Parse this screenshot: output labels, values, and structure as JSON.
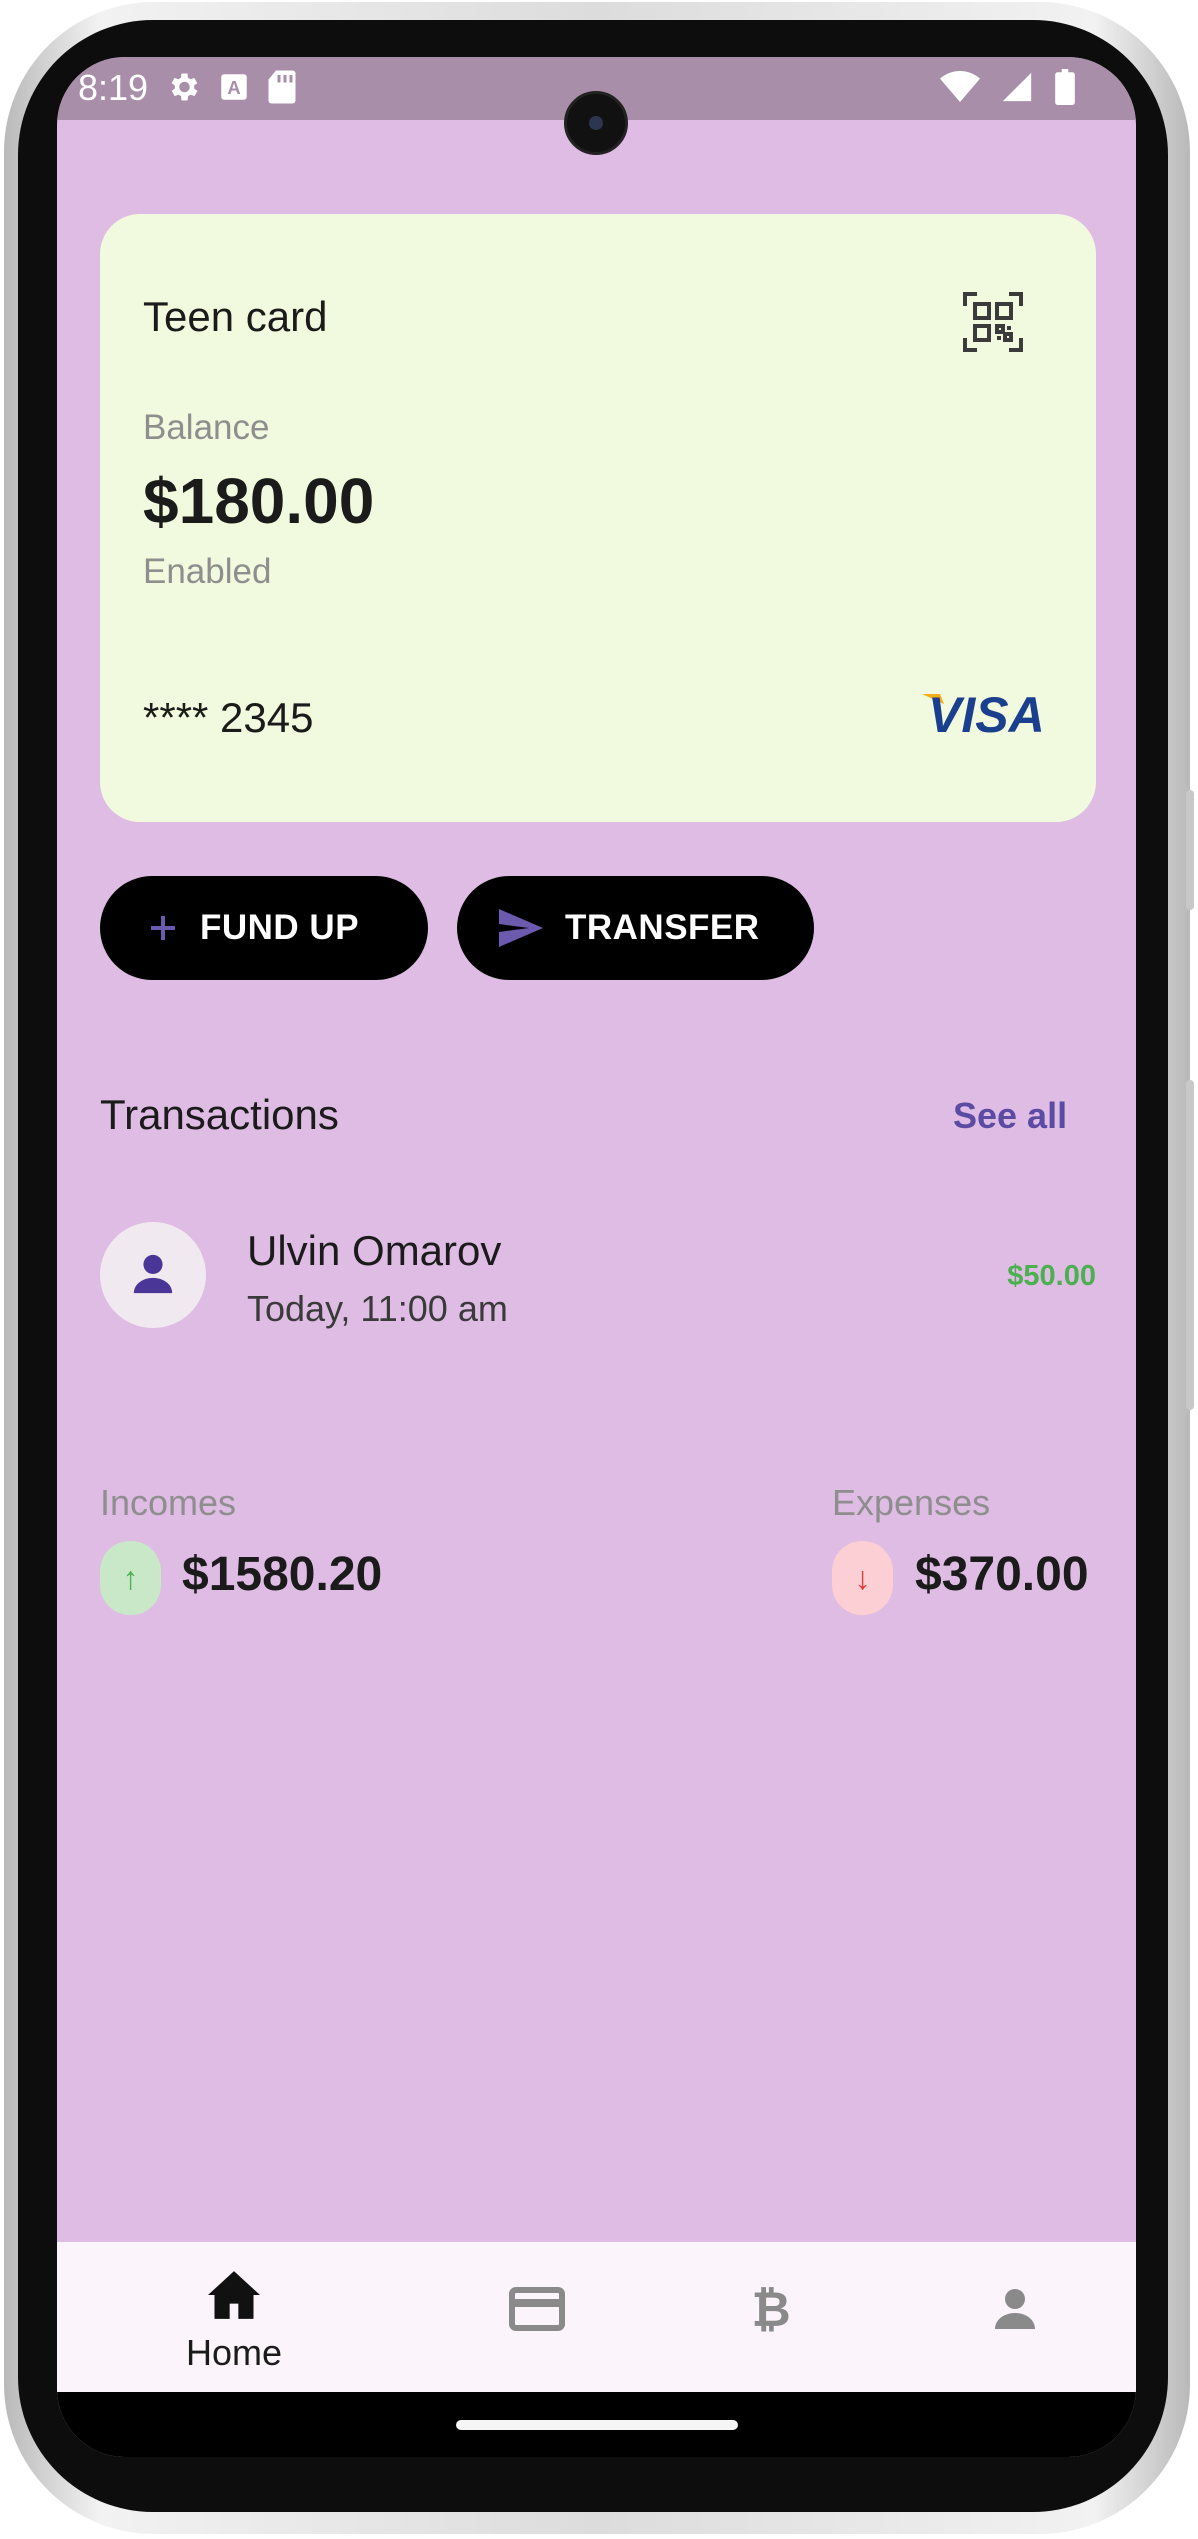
{
  "status_bar": {
    "time": "8:19",
    "left_icons": [
      "gear-icon",
      "keyboard-a-icon",
      "sd-card-icon"
    ],
    "right_icons": [
      "wifi-icon",
      "signal-icon",
      "battery-icon"
    ]
  },
  "card": {
    "title": "Teen card",
    "balance_label": "Balance",
    "balance": "$180.00",
    "status": "Enabled",
    "number": "**** 2345",
    "brand": "VISA",
    "qr_icon": "qr-code-scan-icon"
  },
  "actions": {
    "fund_up_label": "FUND UP",
    "transfer_label": "TRANSFER",
    "accent_color": "#6b5aad"
  },
  "transactions": {
    "title": "Transactions",
    "see_all_label": "See all",
    "items": [
      {
        "name": "Ulvin Omarov",
        "time": "Today, 11:00 am",
        "amount": "$50.00",
        "avatar_icon": "person-icon"
      }
    ]
  },
  "stats": {
    "incomes_label": "Incomes",
    "incomes_value": "$1580.20",
    "expenses_label": "Expenses",
    "expenses_value": "$370.00",
    "income_color": "#4caf50",
    "expense_color": "#e53935"
  },
  "bottom_nav": {
    "items": [
      {
        "label": "Home",
        "icon": "home-icon",
        "active": true
      },
      {
        "label": "",
        "icon": "credit-card-icon",
        "active": false
      },
      {
        "label": "",
        "icon": "bitcoin-icon",
        "active": false
      },
      {
        "label": "",
        "icon": "person-icon",
        "active": false
      }
    ]
  },
  "colors": {
    "background": "#dfbce4",
    "card": "#f1fade",
    "status_bar": "#a98ea9",
    "nav_bar": "#fbf4fa",
    "link": "#5b4ba3"
  }
}
